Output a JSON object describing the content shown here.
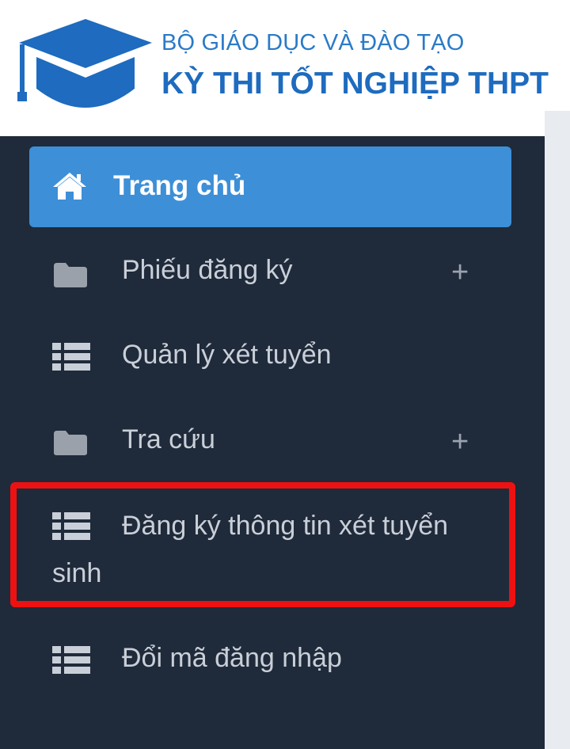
{
  "brand": {
    "line1": "BỘ GIÁO DỤC VÀ ĐÀO TẠO",
    "line2": "KỲ THI TỐT NGHIỆP THPT",
    "logo_icon": "graduation-cap-icon",
    "color": "#1e6bbf"
  },
  "menu": {
    "home": {
      "label": "Trang chủ",
      "icon": "home-icon"
    },
    "items": [
      {
        "label": "Phiếu đăng ký",
        "icon": "folder-icon",
        "expand": "+"
      },
      {
        "label": "Quản lý xét tuyển",
        "icon": "list-icon"
      },
      {
        "label": "Tra cứu",
        "icon": "folder-icon",
        "expand": "+"
      },
      {
        "label_line1": "Đăng ký thông tin xét tuyển",
        "label_line2": "sinh",
        "icon": "list-icon"
      },
      {
        "label": "Đổi mã đăng nhập",
        "icon": "list-icon"
      }
    ]
  },
  "colors": {
    "sidebar_bg": "#1f2a3a",
    "active_bg": "#3d8fd8",
    "highlight": "#ee1111"
  }
}
